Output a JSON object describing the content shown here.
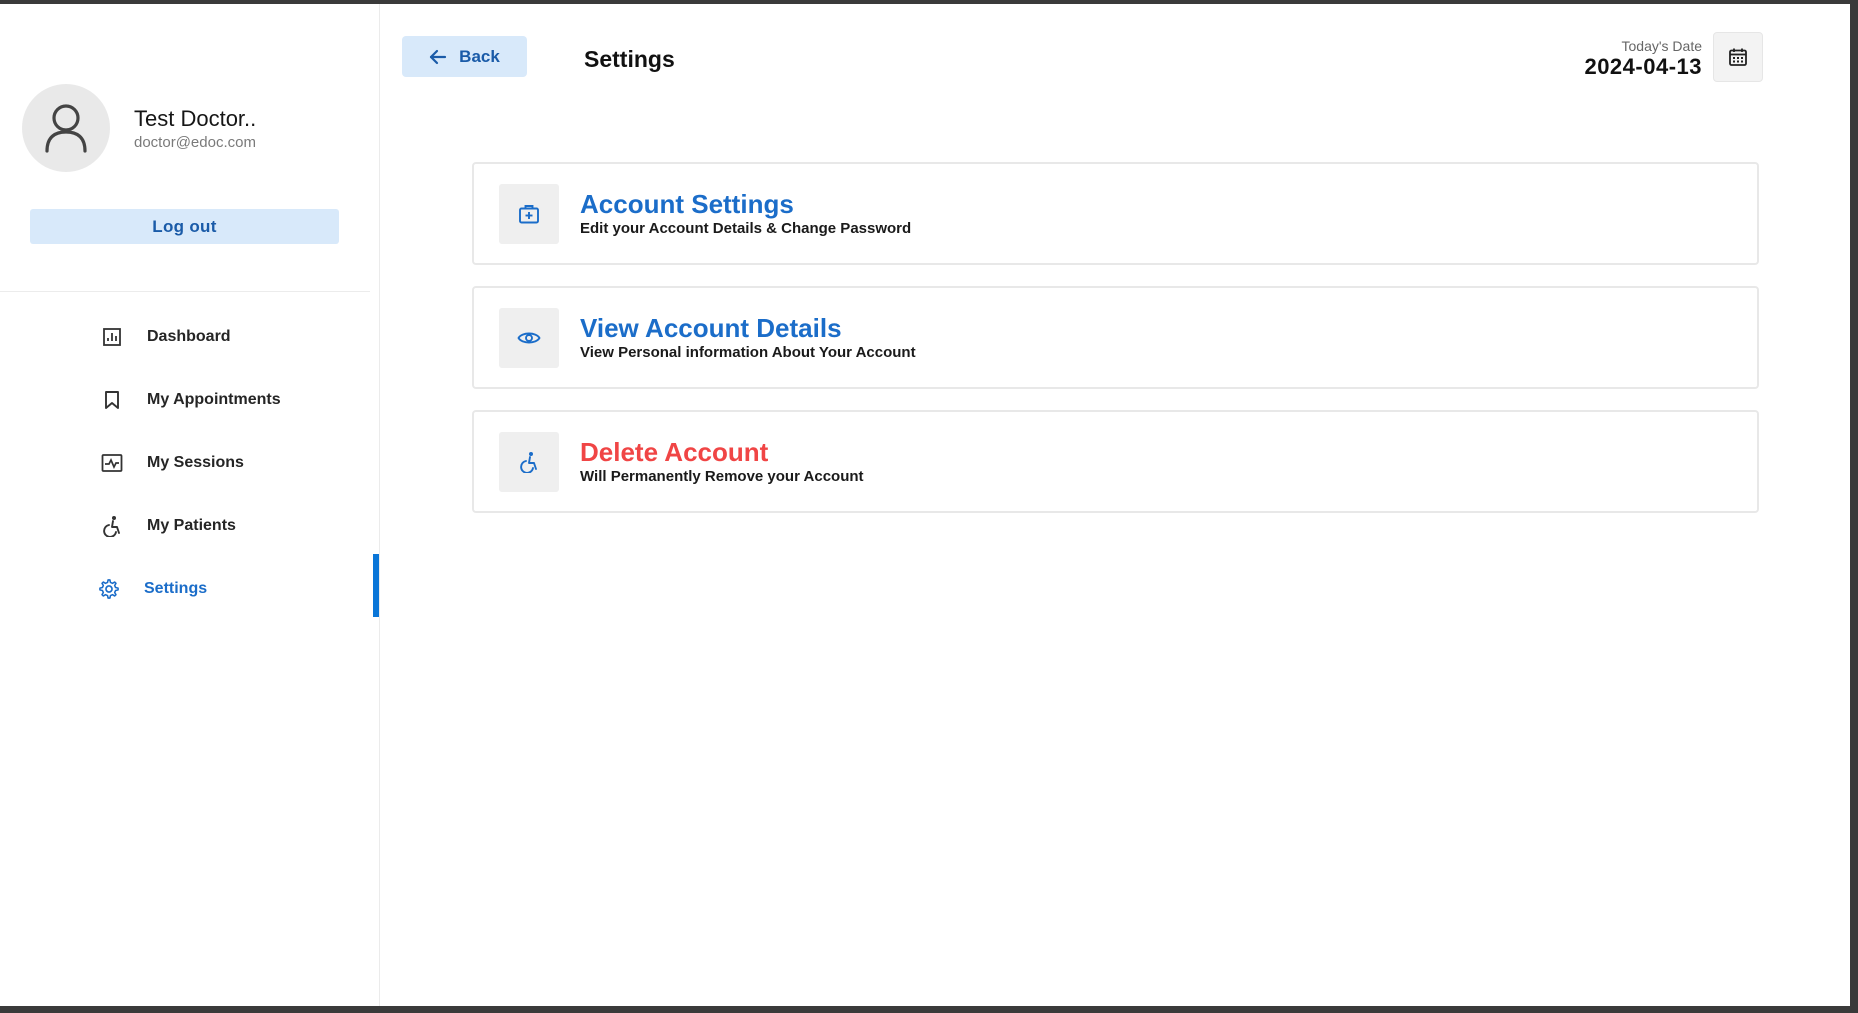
{
  "sidebar": {
    "profile": {
      "name": "Test Doctor..",
      "email": "doctor@edoc.com"
    },
    "logout_label": "Log out",
    "items": [
      {
        "label": "Dashboard",
        "icon": "dashboard-icon"
      },
      {
        "label": "My Appointments",
        "icon": "bookmark-icon"
      },
      {
        "label": "My Sessions",
        "icon": "schedule-icon"
      },
      {
        "label": "My Patients",
        "icon": "wheelchair-icon"
      },
      {
        "label": "Settings",
        "icon": "gear-icon",
        "active": true
      }
    ]
  },
  "header": {
    "back_label": "Back",
    "title": "Settings",
    "date_label": "Today's Date",
    "date_value": "2024-04-13"
  },
  "cards": [
    {
      "title": "Account Settings",
      "subtitle": "Edit your Account Details & Change Password",
      "icon": "medical-bag-icon"
    },
    {
      "title": "View Account Details",
      "subtitle": "View Personal information About Your Account",
      "icon": "eye-icon"
    },
    {
      "title": "Delete Account",
      "subtitle": "Will Permanently Remove your Account",
      "icon": "wheelchair-icon"
    }
  ],
  "colors": {
    "accent": "#1b6dc9",
    "accent_light": "#d8e9fa",
    "danger": "#f04545",
    "active_bar": "#0a76d8"
  }
}
